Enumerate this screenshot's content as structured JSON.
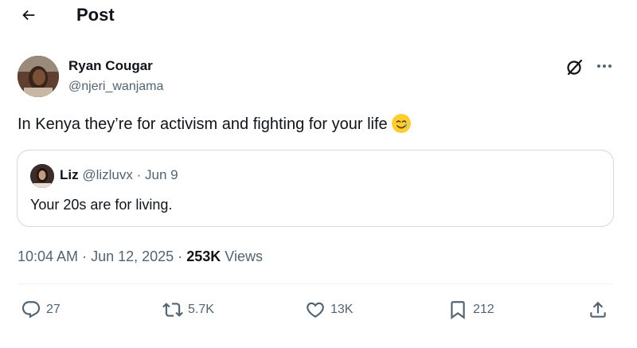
{
  "header": {
    "title": "Post",
    "back_icon": "arrow-left-icon"
  },
  "post": {
    "author_name": "Ryan Cougar",
    "author_handle": "@njeri_wanjama",
    "text": "In Kenya they’re for activism and fighting for your life",
    "emoji": "🥲",
    "quote": {
      "name": "Liz",
      "handle": "@lizluvx",
      "separator": "·",
      "date": "Jun 9",
      "text": "Your 20s are for living."
    },
    "time": "10:04 AM",
    "dot1": "·",
    "date": "Jun 12, 2025",
    "dot2": "·",
    "views_count": "253K",
    "views_label": "Views"
  },
  "actions": {
    "replies": "27",
    "reposts": "5.7K",
    "likes": "13K",
    "bookmarks": "212"
  },
  "colors": {
    "text_primary": "#0f1419",
    "text_secondary": "#536471",
    "border": "#cfd9de"
  }
}
